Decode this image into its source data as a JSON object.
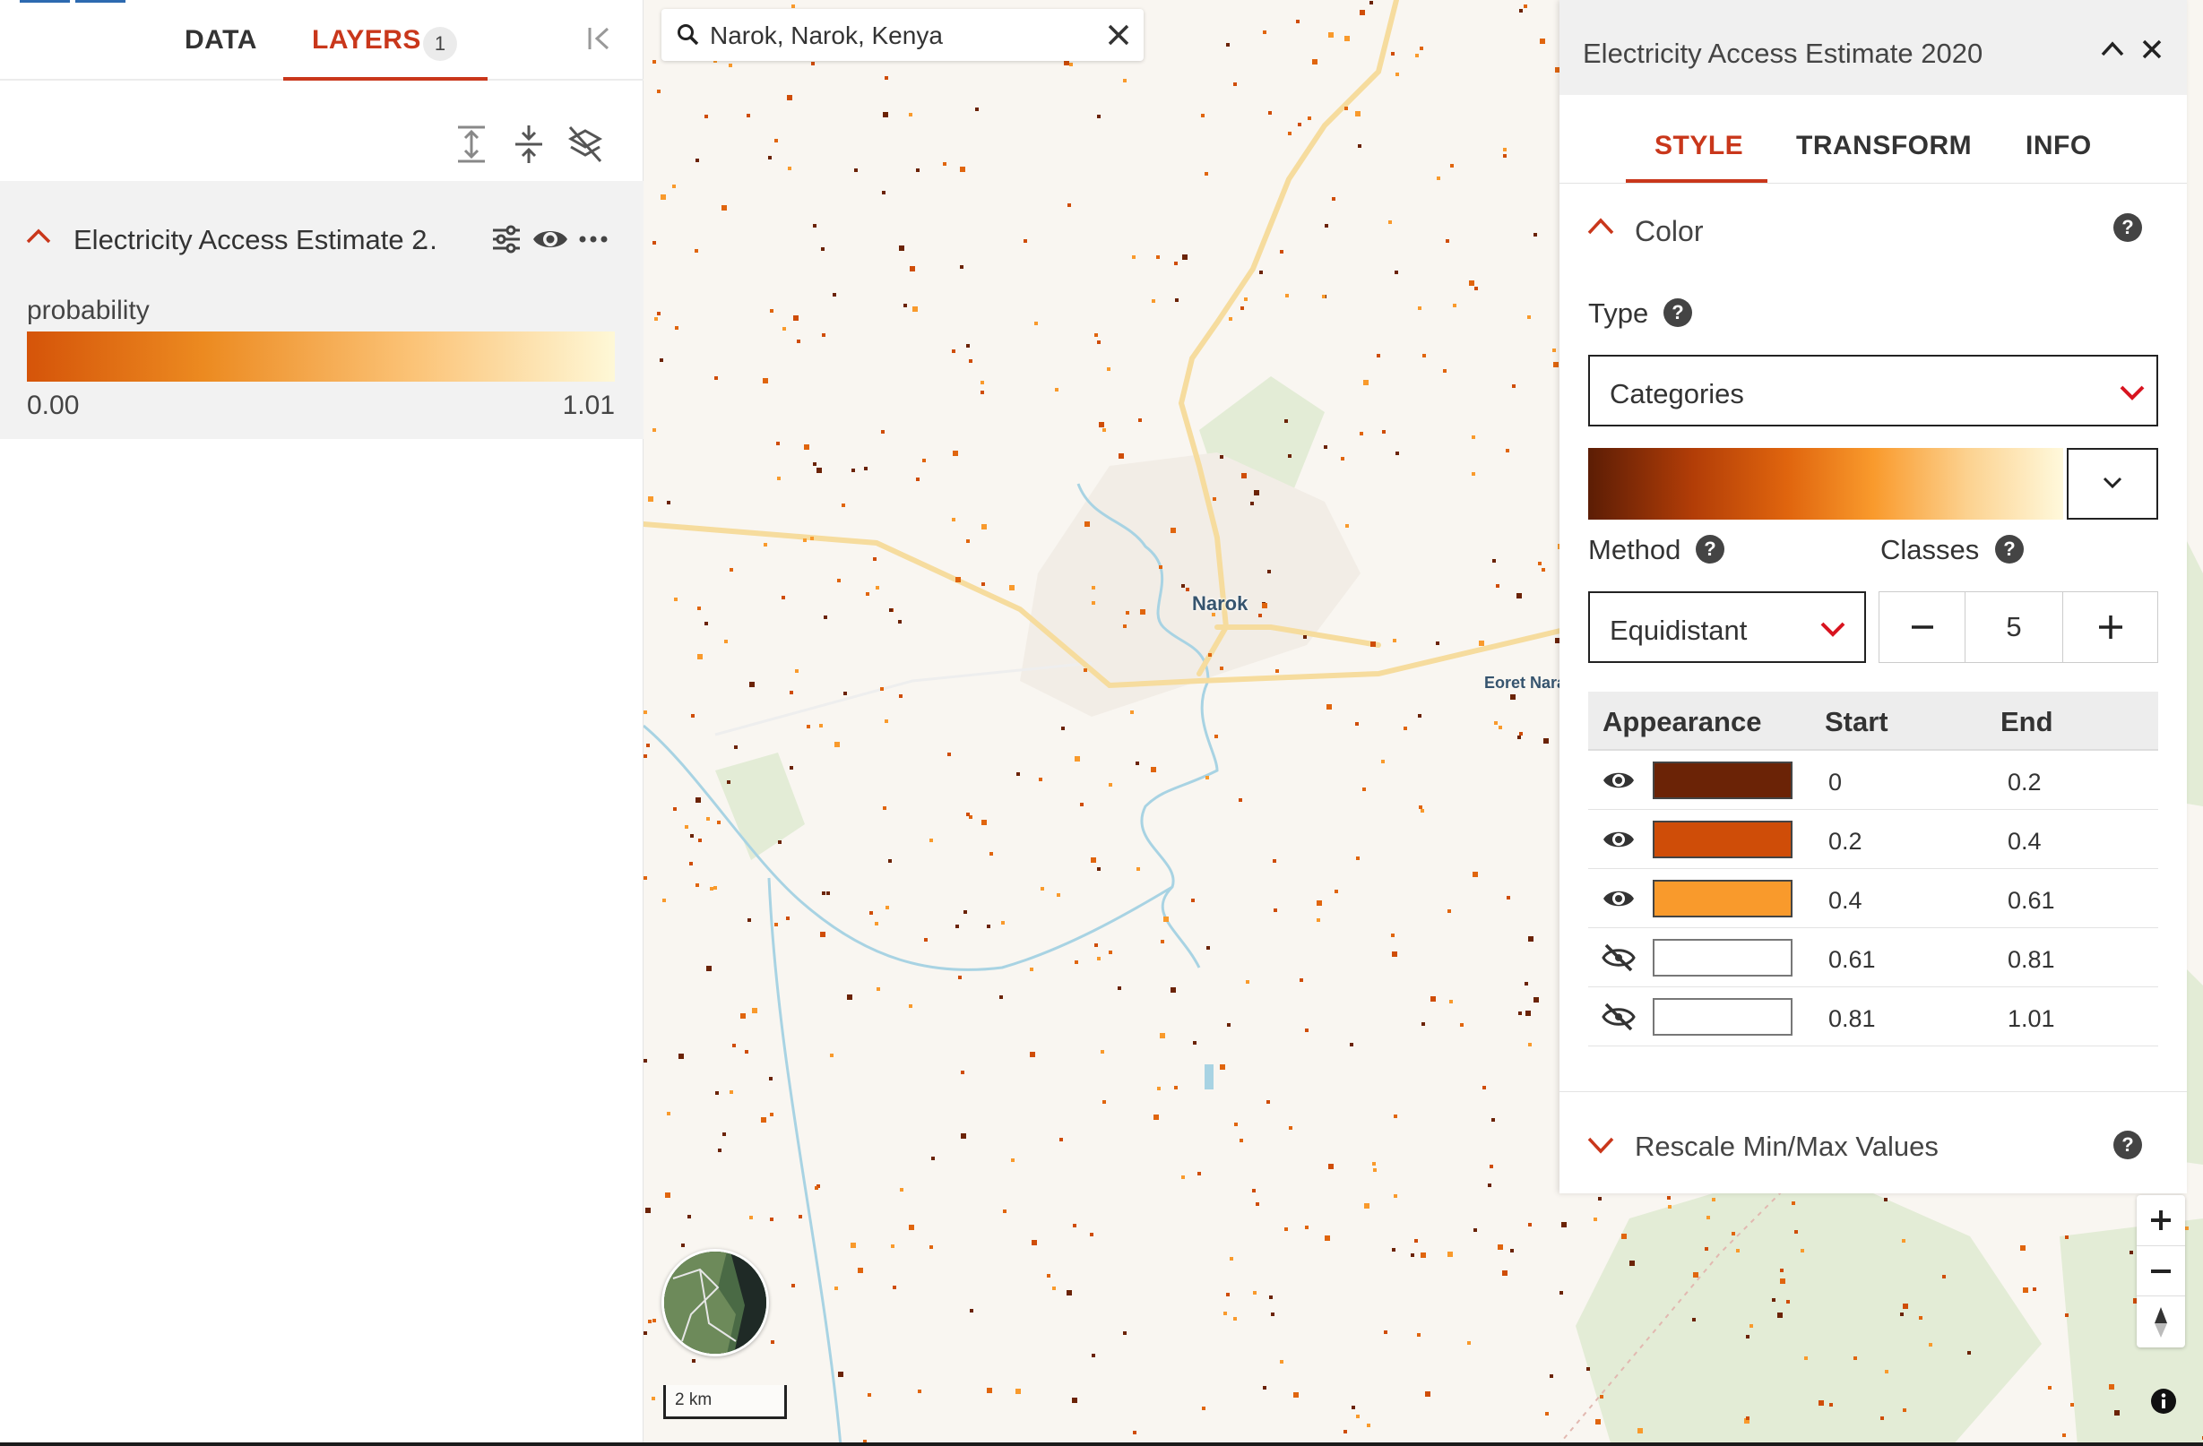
{
  "left_panel": {
    "tabs": [
      {
        "label": "DATA",
        "active": false
      },
      {
        "label": "LAYERS",
        "active": true,
        "badge": "1"
      }
    ],
    "toolbar_icons": [
      "expand-all-icon",
      "collapse-all-icon",
      "hide-all-layers-icon"
    ],
    "layer": {
      "title": "Electricity Access Estimate 2",
      "title_ellipsis": "...",
      "actions": [
        "layer-settings-icon",
        "visibility-eye-icon",
        "more-options-icon"
      ],
      "legend": {
        "label": "probability",
        "min": "0.00",
        "max": "1.01",
        "colors": [
          "#d55409",
          "#ec8a20",
          "#fbc275",
          "#fef8d7"
        ]
      }
    }
  },
  "search": {
    "value": "Narok, Narok, Kenya",
    "icons": [
      "search-icon",
      "clear-icon"
    ]
  },
  "style_panel": {
    "title": "Electricity Access Estimate 2020",
    "tabs": [
      {
        "label": "STYLE",
        "active": true
      },
      {
        "label": "TRANSFORM",
        "active": false
      },
      {
        "label": "INFO",
        "active": false
      }
    ],
    "color_section": {
      "label": "Color",
      "expanded": true
    },
    "type": {
      "label": "Type",
      "value": "Categories"
    },
    "ramp_colors": [
      "#5c1d05",
      "#b23d07",
      "#e0650e",
      "#f99a2c",
      "#fcd290",
      "#fff9dc"
    ],
    "method": {
      "label": "Method",
      "value": "Equidistant"
    },
    "classes": {
      "label": "Classes",
      "value": "5"
    },
    "table": {
      "headers": [
        "Appearance",
        "Start",
        "End"
      ],
      "rows": [
        {
          "visible": true,
          "color": "#6b2306",
          "start": "0",
          "end": "0.2"
        },
        {
          "visible": true,
          "color": "#cf4d08",
          "start": "0.2",
          "end": "0.4"
        },
        {
          "visible": true,
          "color": "#f99a2c",
          "start": "0.4",
          "end": "0.61"
        },
        {
          "visible": false,
          "color": "#ffffff",
          "start": "0.61",
          "end": "0.81"
        },
        {
          "visible": false,
          "color": "#ffffff",
          "start": "0.81",
          "end": "1.01"
        }
      ]
    },
    "rescale_section": {
      "label": "Rescale Min/Max Values",
      "expanded": false
    }
  },
  "map": {
    "place_label": "Narok",
    "place_label_2": "Eoret Nara",
    "scale_label": "2 km",
    "accent_color": "#c9371b",
    "road_color": "#f6dc9e",
    "river_color": "#a8d3e3",
    "vegetation_color": "#e2ecd6",
    "marker_color": "#3b7ded"
  }
}
